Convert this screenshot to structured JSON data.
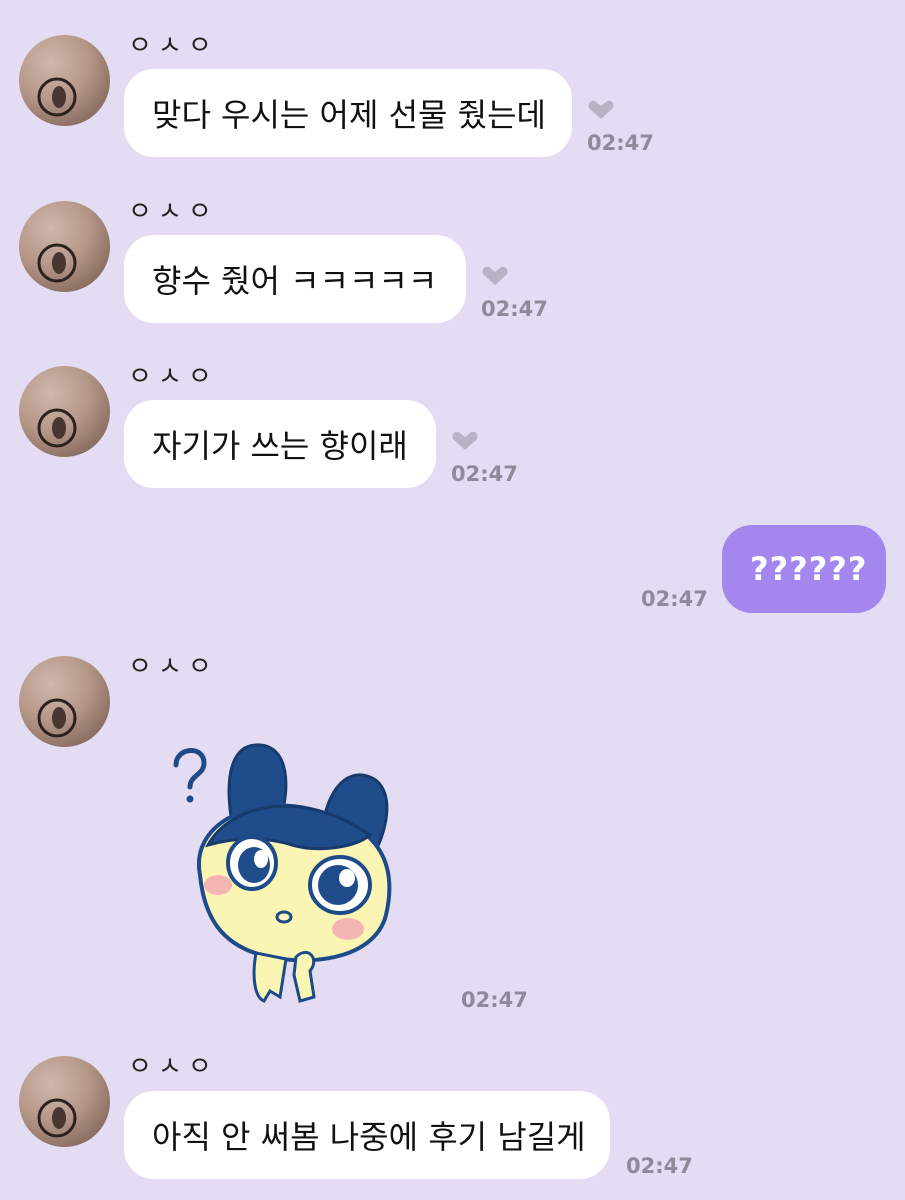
{
  "chat": {
    "messages": [
      {
        "sender": "ㅇㅅㅇ",
        "text": "맞다 우시는 어제 선물 줬는데",
        "time": "02:47"
      },
      {
        "sender": "ㅇㅅㅇ",
        "text": "향수 줬어 ㅋㅋㅋㅋㅋ",
        "time": "02:47"
      },
      {
        "sender": "ㅇㅅㅇ",
        "text": "자기가 쓰는 향이래",
        "time": "02:47"
      },
      {
        "text": "??????",
        "time": "02:47"
      },
      {
        "sender": "ㅇㅅㅇ",
        "sticker": "question-mark-character-sticker",
        "time": "02:47"
      },
      {
        "sender": "ㅇㅅㅇ",
        "text": "아직 안 써봄 나중에 후기 남길게",
        "time": "02:47"
      }
    ]
  },
  "colors": {
    "background": "#e3dcf2",
    "bubble_incoming": "#ffffff",
    "bubble_outgoing": "#a486ef",
    "timestamp": "#8f8a99"
  },
  "icons": {
    "reaction": "heart-tag-icon",
    "avatar": "profile-avatar"
  }
}
